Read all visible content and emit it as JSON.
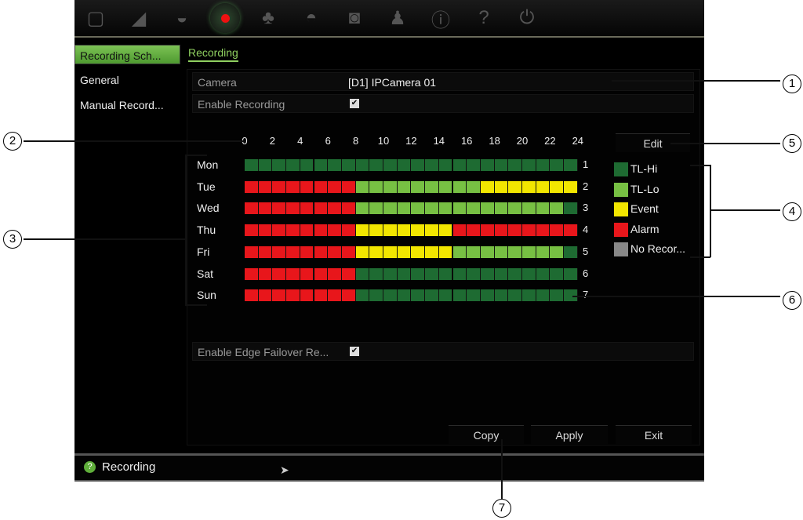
{
  "toolbar": {
    "icons": [
      "live-view-icon",
      "camera-icon",
      "display-icon",
      "recording-icon",
      "alarm-icon",
      "network-icon",
      "hdd-icon",
      "user-icon",
      "info-icon",
      "help-icon",
      "power-icon"
    ],
    "active": "recording-icon"
  },
  "sidebar": {
    "items": [
      {
        "label": "Recording Sch...",
        "active": true
      },
      {
        "label": "General"
      },
      {
        "label": "Manual Record..."
      }
    ]
  },
  "tab": {
    "label": "Recording"
  },
  "camera": {
    "label": "Camera",
    "value": "[D1] IPCamera 01"
  },
  "enable_recording": {
    "label": "Enable Recording",
    "checked": true
  },
  "edge_failover": {
    "label": "Enable Edge Failover Re...",
    "checked": true
  },
  "schedule": {
    "hours": [
      "0",
      "2",
      "4",
      "6",
      "8",
      "10",
      "12",
      "14",
      "16",
      "18",
      "20",
      "22",
      "24"
    ],
    "days": [
      {
        "label": "Mon",
        "num": "1",
        "segments": [
          [
            "TL-Hi",
            0,
            24
          ]
        ]
      },
      {
        "label": "Tue",
        "num": "2",
        "segments": [
          [
            "Alarm",
            0,
            8
          ],
          [
            "TL-Lo",
            8,
            17
          ],
          [
            "Event",
            17,
            24
          ]
        ]
      },
      {
        "label": "Wed",
        "num": "3",
        "segments": [
          [
            "Alarm",
            0,
            8
          ],
          [
            "TL-Lo",
            8,
            23
          ],
          [
            "TL-Hi",
            23,
            24
          ]
        ]
      },
      {
        "label": "Thu",
        "num": "4",
        "segments": [
          [
            "Alarm",
            0,
            8
          ],
          [
            "Event",
            8,
            15
          ],
          [
            "Alarm",
            15,
            24
          ]
        ]
      },
      {
        "label": "Fri",
        "num": "5",
        "segments": [
          [
            "Alarm",
            0,
            8
          ],
          [
            "Event",
            8,
            15
          ],
          [
            "TL-Lo",
            15,
            23
          ],
          [
            "TL-Hi",
            23,
            24
          ]
        ]
      },
      {
        "label": "Sat",
        "num": "6",
        "segments": [
          [
            "Alarm",
            0,
            8
          ],
          [
            "TL-Hi",
            8,
            24
          ]
        ]
      },
      {
        "label": "Sun",
        "num": "7",
        "segments": [
          [
            "Alarm",
            0,
            8
          ],
          [
            "TL-Hi",
            8,
            24
          ]
        ]
      }
    ]
  },
  "legend": [
    {
      "label": "TL-Hi",
      "color": "#1e6b32"
    },
    {
      "label": "TL-Lo",
      "color": "#77c043"
    },
    {
      "label": "Event",
      "color": "#f2e600"
    },
    {
      "label": "Alarm",
      "color": "#e8161b"
    },
    {
      "label": "No Recor...",
      "color": "#888888"
    }
  ],
  "buttons": {
    "edit": "Edit",
    "copy": "Copy",
    "apply": "Apply",
    "exit": "Exit"
  },
  "status": {
    "text": "Recording"
  },
  "callouts": [
    "1",
    "2",
    "3",
    "4",
    "5",
    "6",
    "7"
  ]
}
